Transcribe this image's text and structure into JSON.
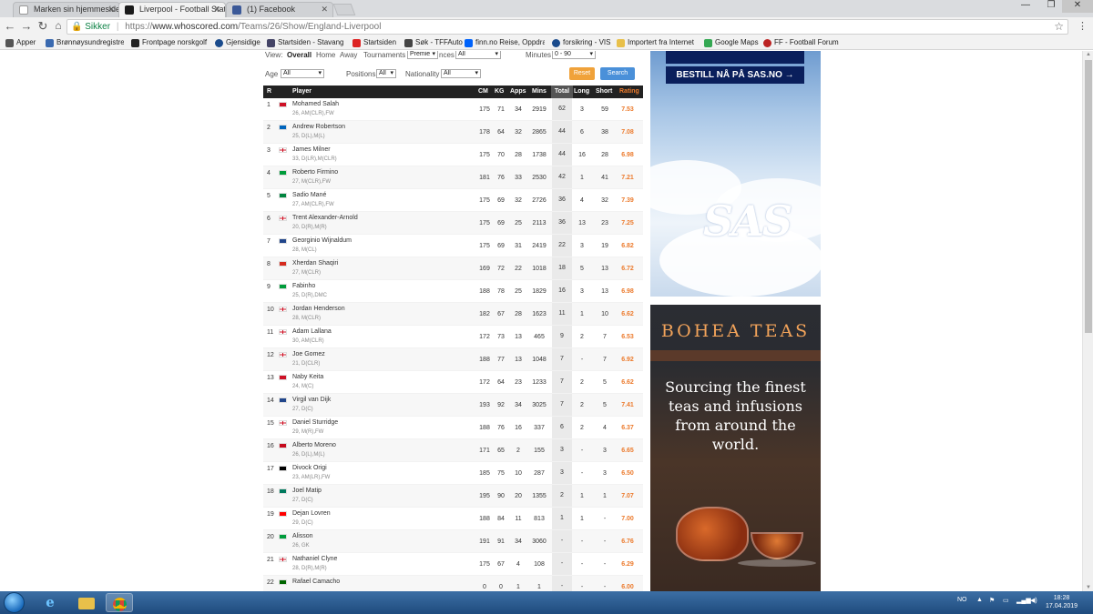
{
  "browser": {
    "tabs": [
      {
        "label": "Marken sin hjemmeside",
        "active": false
      },
      {
        "label": "Liverpool - Football Stati",
        "active": true
      },
      {
        "label": "(1) Facebook",
        "active": false
      }
    ],
    "secure_label": "Sikker",
    "url_prefix": "https://",
    "url_host": "www.whoscored.com",
    "url_path": "/Teams/26/Show/England-Liverpool",
    "bookmarks": [
      {
        "label": "Apper",
        "color": "#555"
      },
      {
        "label": "Brønnøysundregistre",
        "color": "#3a6ab0"
      },
      {
        "label": "Frontpage norskgolf",
        "color": "#222"
      },
      {
        "label": "Gjensidige",
        "color": "#1a4b8c"
      },
      {
        "label": "Startsiden - Stavange",
        "color": "#446"
      },
      {
        "label": "Startsiden",
        "color": "#d22"
      },
      {
        "label": "Søk - TFFAuto",
        "color": "#444"
      },
      {
        "label": "finn.no Reise, Oppdra",
        "color": "#0063fb"
      },
      {
        "label": "forsikring - VIS",
        "color": "#1a4b8c"
      },
      {
        "label": "Importert fra Internet",
        "color": "#e8c04a"
      },
      {
        "label": "Google Maps",
        "color": "#34a853"
      },
      {
        "label": "FF - Football Forum",
        "color": "#b22"
      }
    ]
  },
  "filters": {
    "view_label": "View:",
    "view_options": [
      "Overall",
      "Home",
      "Away"
    ],
    "view_selected": "Overall",
    "tournaments_label": "Tournaments",
    "tournaments_value": "Premie",
    "appearances_label": "nces",
    "appearances_value": "All",
    "minutes_label": "Minutes",
    "minutes_value": "0 - 90",
    "age_label": "Age",
    "age_value": "All",
    "positions_label": "Positions",
    "positions_value": "All",
    "nationality_label": "Nationality",
    "nationality_value": "All",
    "reset_label": "Reset",
    "search_label": "Search"
  },
  "table": {
    "headers": {
      "r": "R",
      "player": "Player",
      "cm": "CM",
      "kg": "KG",
      "apps": "Apps",
      "mins": "Mins",
      "total": "Total",
      "long": "Long",
      "short": "Short",
      "rating": "Rating"
    },
    "rows": [
      {
        "r": "1",
        "name": "Mohamed Salah",
        "meta": "26, AM(CLR),FW",
        "cm": "175",
        "kg": "71",
        "apps": "34",
        "mins": "2919",
        "total": "62",
        "long": "3",
        "short": "59",
        "rating": "7.53",
        "flag": "eg"
      },
      {
        "r": "2",
        "name": "Andrew Robertson",
        "meta": "25, D(L),M(L)",
        "cm": "178",
        "kg": "64",
        "apps": "32",
        "mins": "2865",
        "total": "44",
        "long": "6",
        "short": "38",
        "rating": "7.08",
        "flag": "sc"
      },
      {
        "r": "3",
        "name": "James Milner",
        "meta": "33, D(LR),M(CLR)",
        "cm": "175",
        "kg": "70",
        "apps": "28",
        "mins": "1738",
        "total": "44",
        "long": "16",
        "short": "28",
        "rating": "6.98",
        "flag": "en"
      },
      {
        "r": "4",
        "name": "Roberto Firmino",
        "meta": "27, M(CLR),FW",
        "cm": "181",
        "kg": "76",
        "apps": "33",
        "mins": "2530",
        "total": "42",
        "long": "1",
        "short": "41",
        "rating": "7.21",
        "flag": "br"
      },
      {
        "r": "5",
        "name": "Sadio Mané",
        "meta": "27, AM(CLR),FW",
        "cm": "175",
        "kg": "69",
        "apps": "32",
        "mins": "2726",
        "total": "36",
        "long": "4",
        "short": "32",
        "rating": "7.39",
        "flag": "sn"
      },
      {
        "r": "6",
        "name": "Trent Alexander-Arnold",
        "meta": "20, D(R),M(R)",
        "cm": "175",
        "kg": "69",
        "apps": "25",
        "mins": "2113",
        "total": "36",
        "long": "13",
        "short": "23",
        "rating": "7.25",
        "flag": "en"
      },
      {
        "r": "7",
        "name": "Georginio Wijnaldum",
        "meta": "28, M(CL)",
        "cm": "175",
        "kg": "69",
        "apps": "31",
        "mins": "2419",
        "total": "22",
        "long": "3",
        "short": "19",
        "rating": "6.82",
        "flag": "nl"
      },
      {
        "r": "8",
        "name": "Xherdan Shaqiri",
        "meta": "27, M(CLR)",
        "cm": "169",
        "kg": "72",
        "apps": "22",
        "mins": "1018",
        "total": "18",
        "long": "5",
        "short": "13",
        "rating": "6.72",
        "flag": "ch"
      },
      {
        "r": "9",
        "name": "Fabinho",
        "meta": "25, D(R),DMC",
        "cm": "188",
        "kg": "78",
        "apps": "25",
        "mins": "1829",
        "total": "16",
        "long": "3",
        "short": "13",
        "rating": "6.98",
        "flag": "br"
      },
      {
        "r": "10",
        "name": "Jordan Henderson",
        "meta": "28, M(CLR)",
        "cm": "182",
        "kg": "67",
        "apps": "28",
        "mins": "1623",
        "total": "11",
        "long": "1",
        "short": "10",
        "rating": "6.62",
        "flag": "en"
      },
      {
        "r": "11",
        "name": "Adam Lallana",
        "meta": "30, AM(CLR)",
        "cm": "172",
        "kg": "73",
        "apps": "13",
        "mins": "465",
        "total": "9",
        "long": "2",
        "short": "7",
        "rating": "6.53",
        "flag": "en"
      },
      {
        "r": "12",
        "name": "Joe Gomez",
        "meta": "21, D(CLR)",
        "cm": "188",
        "kg": "77",
        "apps": "13",
        "mins": "1048",
        "total": "7",
        "long": "-",
        "short": "7",
        "rating": "6.92",
        "flag": "en"
      },
      {
        "r": "13",
        "name": "Naby Keita",
        "meta": "24, M(C)",
        "cm": "172",
        "kg": "64",
        "apps": "23",
        "mins": "1233",
        "total": "7",
        "long": "2",
        "short": "5",
        "rating": "6.62",
        "flag": "gn"
      },
      {
        "r": "14",
        "name": "Virgil van Dijk",
        "meta": "27, D(C)",
        "cm": "193",
        "kg": "92",
        "apps": "34",
        "mins": "3025",
        "total": "7",
        "long": "2",
        "short": "5",
        "rating": "7.41",
        "flag": "nl"
      },
      {
        "r": "15",
        "name": "Daniel Sturridge",
        "meta": "29, M(R),FW",
        "cm": "188",
        "kg": "76",
        "apps": "16",
        "mins": "337",
        "total": "6",
        "long": "2",
        "short": "4",
        "rating": "6.37",
        "flag": "en"
      },
      {
        "r": "16",
        "name": "Alberto Moreno",
        "meta": "26, D(L),M(L)",
        "cm": "171",
        "kg": "65",
        "apps": "2",
        "mins": "155",
        "total": "3",
        "long": "-",
        "short": "3",
        "rating": "6.65",
        "flag": "es"
      },
      {
        "r": "17",
        "name": "Divock Origi",
        "meta": "23, AM(LR),FW",
        "cm": "185",
        "kg": "75",
        "apps": "10",
        "mins": "287",
        "total": "3",
        "long": "-",
        "short": "3",
        "rating": "6.50",
        "flag": "be"
      },
      {
        "r": "18",
        "name": "Joel Matip",
        "meta": "27, D(C)",
        "cm": "195",
        "kg": "90",
        "apps": "20",
        "mins": "1355",
        "total": "2",
        "long": "1",
        "short": "1",
        "rating": "7.07",
        "flag": "cm"
      },
      {
        "r": "19",
        "name": "Dejan Lovren",
        "meta": "29, D(C)",
        "cm": "188",
        "kg": "84",
        "apps": "11",
        "mins": "813",
        "total": "1",
        "long": "1",
        "short": "-",
        "rating": "7.00",
        "flag": "hr"
      },
      {
        "r": "20",
        "name": "Alisson",
        "meta": "26, GK",
        "cm": "191",
        "kg": "91",
        "apps": "34",
        "mins": "3060",
        "total": "-",
        "long": "-",
        "short": "-",
        "rating": "6.76",
        "flag": "br"
      },
      {
        "r": "21",
        "name": "Nathaniel Clyne",
        "meta": "28, D(R),M(R)",
        "cm": "175",
        "kg": "67",
        "apps": "4",
        "mins": "108",
        "total": "-",
        "long": "-",
        "short": "-",
        "rating": "6.29",
        "flag": "en"
      },
      {
        "r": "22",
        "name": "Rafael Camacho",
        "meta": "",
        "cm": "0",
        "kg": "0",
        "apps": "1",
        "mins": "1",
        "total": "-",
        "long": "-",
        "short": "-",
        "rating": "6.00",
        "flag": "pt"
      }
    ]
  },
  "ads": {
    "sas_cta": "BESTILL NÅ PÅ SAS.NO →",
    "sas_logo": "SAS",
    "bohea_brand": "BOHEA TEAS",
    "bohea_tagline": "Sourcing the finest teas and infusions from around the world."
  },
  "taskbar": {
    "lang": "NO",
    "time": "18:28",
    "date": "17.04.2019"
  },
  "flag_colors": {
    "eg": "#ce1126",
    "sc": "#0065bd",
    "en": "#ffffff",
    "br": "#009c3b",
    "sn": "#00853f",
    "nl": "#21468b",
    "ch": "#d52b1e",
    "gn": "#ce1126",
    "es": "#c60b1e",
    "be": "#000000",
    "cm": "#007a5e",
    "hr": "#ff0000",
    "pt": "#006600"
  },
  "colors": {
    "rating": "#ec7a2c",
    "header_bg": "#222222",
    "reset": "#f0a23a",
    "search": "#4a90d9"
  }
}
